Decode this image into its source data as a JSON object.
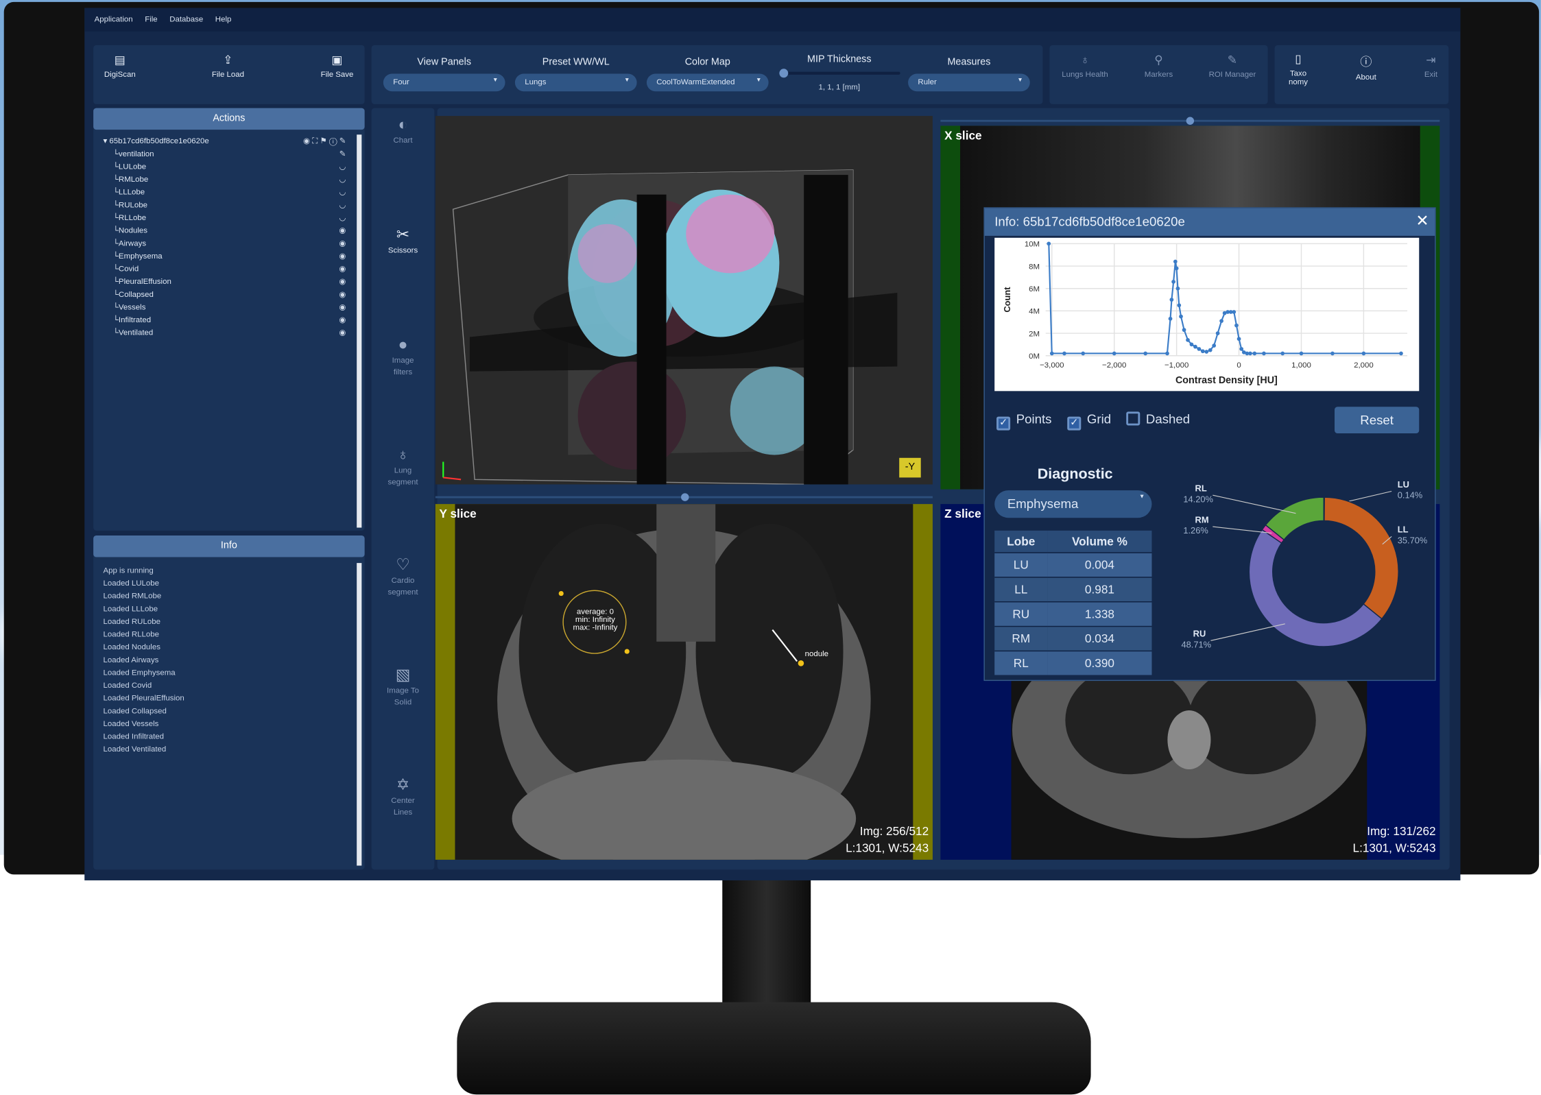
{
  "menu": [
    "Application",
    "File",
    "Database",
    "Help"
  ],
  "toolbar_left": [
    {
      "label": "DigiScan",
      "icon": "scan-icon"
    },
    {
      "label": "File Load",
      "icon": "upload-icon"
    },
    {
      "label": "File Save",
      "icon": "save-icon"
    }
  ],
  "controls": {
    "view_panels": {
      "label": "View Panels",
      "value": "Four"
    },
    "preset_wwwl": {
      "label": "Preset WW/WL",
      "value": "Lungs"
    },
    "color_map": {
      "label": "Color Map",
      "value": "CoolToWarmExtended"
    },
    "mip_thickness": {
      "label": "MIP Thickness",
      "value": "1, 1, 1 [mm]"
    },
    "measures": {
      "label": "Measures",
      "value": "Ruler"
    }
  },
  "toolbar_right": [
    {
      "label": "Lungs Health",
      "icon": "lungs-icon",
      "enabled": false
    },
    {
      "label": "Markers",
      "icon": "search-icon",
      "enabled": false
    },
    {
      "label": "ROI Manager",
      "icon": "pen-icon",
      "enabled": false
    },
    {
      "label": "Taxo\nnomy",
      "icon": "book-icon",
      "enabled": true
    },
    {
      "label": "About",
      "icon": "info-icon",
      "enabled": true
    },
    {
      "label": "Exit",
      "icon": "exit-icon",
      "enabled": false
    }
  ],
  "actions": {
    "title": "Actions",
    "root": "65b17cd6fb50df8ce1e0620e",
    "items": [
      "ventilation",
      "LULobe",
      "RMLobe",
      "LLLobe",
      "RULobe",
      "RLLobe",
      "Nodules",
      "Airways",
      "Emphysema",
      "Covid",
      "PleuralEffusion",
      "Collapsed",
      "Vessels",
      "Infiltrated",
      "Ventilated"
    ]
  },
  "info_panel": {
    "title": "Info",
    "log": [
      "App is running",
      "Loaded LULobe",
      "Loaded RMLobe",
      "Loaded LLLobe",
      "Loaded RULobe",
      "Loaded RLLobe",
      "Loaded Nodules",
      "Loaded Airways",
      "Loaded Emphysema",
      "Loaded Covid",
      "Loaded PleuralEffusion",
      "Loaded Collapsed",
      "Loaded Vessels",
      "Loaded Infiltrated",
      "Loaded Ventilated"
    ]
  },
  "tools": [
    {
      "label": "Chart",
      "icon": "contrast-icon",
      "active": false
    },
    {
      "label": "Scissors",
      "icon": "scissors-icon",
      "active": true
    },
    {
      "label": "Image\nfilters",
      "icon": "filters-icon",
      "active": false
    },
    {
      "label": "Lung\nsegment",
      "icon": "lungs-icon",
      "active": false
    },
    {
      "label": "Cardio\nsegment",
      "icon": "heart-icon",
      "active": false
    },
    {
      "label": "Image To\nSolid",
      "icon": "image-icon",
      "active": false
    },
    {
      "label": "Center\nLines",
      "icon": "centerline-icon",
      "active": false
    }
  ],
  "views": {
    "x_slice": {
      "label": "X slice"
    },
    "y_slice": {
      "label": "Y slice",
      "img": "Img: 256/512",
      "lw": "L:1301, W:5243"
    },
    "z_slice": {
      "label": "Z slice",
      "img": "Img: 131/262",
      "lw": "L:1301, W:5243"
    },
    "volume": {
      "orientation": "-Y"
    }
  },
  "annotations": {
    "roi_stats": [
      "average: 0",
      "min: Infinity",
      "max: -Infinity"
    ],
    "nodule_label": "nodule"
  },
  "dialog": {
    "title": "Info: 65b17cd6fb50df8ce1e0620e",
    "options": [
      {
        "label": "Points",
        "checked": true
      },
      {
        "label": "Grid",
        "checked": true
      },
      {
        "label": "Dashed",
        "checked": false
      }
    ],
    "reset_label": "Reset",
    "diagnostic_label": "Diagnostic",
    "diagnostic_value": "Emphysema",
    "table_headers": [
      "Lobe",
      "Volume %"
    ],
    "table_rows": [
      [
        "LU",
        "0.004"
      ],
      [
        "LL",
        "0.981"
      ],
      [
        "RU",
        "1.338"
      ],
      [
        "RM",
        "0.034"
      ],
      [
        "RL",
        "0.390"
      ]
    ]
  },
  "chart_data": [
    {
      "type": "line",
      "title": "",
      "xlabel": "Contrast Density [HU]",
      "ylabel": "Count",
      "xlim": [
        -3100,
        2700
      ],
      "ylim": [
        0,
        10000000
      ],
      "xticks": [
        "−3,000",
        "−2,000",
        "−1,000",
        "0",
        "1,000",
        "2,000"
      ],
      "xtick_values": [
        -3000,
        -2000,
        -1000,
        0,
        1000,
        2000
      ],
      "yticks": [
        "0M",
        "2M",
        "4M",
        "6M",
        "8M",
        "10M"
      ],
      "ytick_values": [
        0,
        2000000,
        4000000,
        6000000,
        8000000,
        10000000
      ],
      "grid": true,
      "x": [
        -3050,
        -3000,
        -2800,
        -2500,
        -2000,
        -1500,
        -1150,
        -1100,
        -1080,
        -1050,
        -1020,
        -1000,
        -980,
        -960,
        -930,
        -880,
        -820,
        -760,
        -700,
        -640,
        -580,
        -520,
        -460,
        -400,
        -340,
        -280,
        -230,
        -180,
        -130,
        -80,
        -40,
        0,
        40,
        80,
        130,
        180,
        250,
        400,
        700,
        1000,
        1500,
        2000,
        2600
      ],
      "y": [
        10000000,
        200000,
        200000,
        200000,
        200000,
        200000,
        200000,
        3300000,
        5000000,
        6600000,
        8400000,
        7800000,
        6000000,
        4500000,
        3500000,
        2300000,
        1400000,
        1000000,
        800000,
        600000,
        400000,
        350000,
        500000,
        900000,
        2000000,
        3100000,
        3800000,
        3900000,
        3900000,
        3900000,
        2700000,
        1500000,
        600000,
        300000,
        200000,
        200000,
        200000,
        200000,
        200000,
        200000,
        200000,
        200000,
        200000
      ]
    },
    {
      "type": "pie",
      "title": "",
      "categories": [
        "LU",
        "LL",
        "RU",
        "RM",
        "RL"
      ],
      "values": [
        0.14,
        35.7,
        48.71,
        1.26,
        14.2
      ],
      "labels": [
        "0.14%",
        "35.70%",
        "48.71%",
        "1.26%",
        "14.20%"
      ],
      "colors": [
        "#3a7ad8",
        "#c85f1f",
        "#6e6bb8",
        "#d43aa0",
        "#5aa63a"
      ]
    }
  ]
}
